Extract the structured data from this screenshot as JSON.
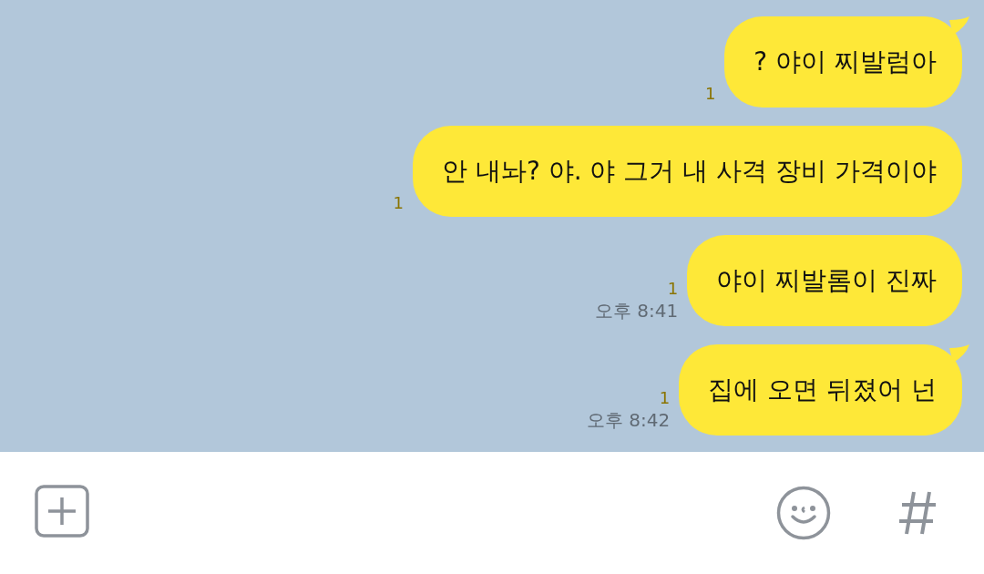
{
  "messages": [
    {
      "text": "? 야이 찌발럼아",
      "unread": "1",
      "tail": true
    },
    {
      "text": "안 내놔? 야. 야 그거 내 사격 장비 가격이야",
      "unread": "1",
      "tail": false
    },
    {
      "text": "야이 찌발롬이 진짜",
      "unread": "1",
      "time": "오후 8:41",
      "tail": false
    },
    {
      "text": "집에 오면 뒤졌어 넌",
      "unread": "1",
      "time": "오후 8:42",
      "tail": true
    }
  ]
}
